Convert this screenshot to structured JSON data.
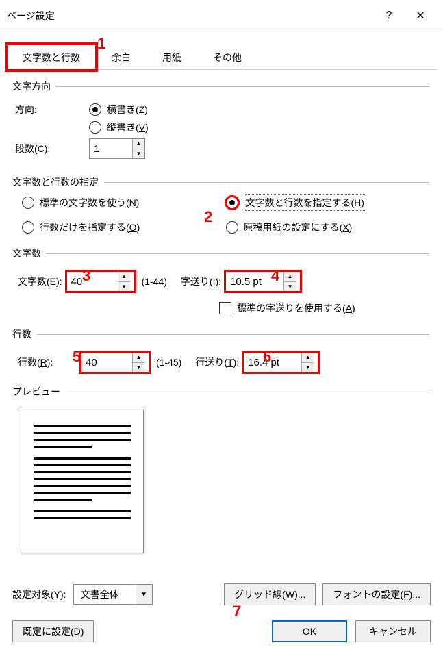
{
  "titlebar": {
    "title": "ページ設定",
    "help_icon": "?",
    "close_icon": "✕"
  },
  "tabs": {
    "t1": "文字数と行数",
    "t2": "余白",
    "t3": "用紙",
    "t4": "その他"
  },
  "direction": {
    "legend": "文字方向",
    "label_direction": "方向:",
    "opt_horizontal": "横書き(Z)",
    "opt_vertical": "縦書き(V)",
    "label_cols": "段数(C):",
    "cols_value": "1"
  },
  "spec": {
    "legend": "文字数と行数の指定",
    "opt_standard": "標準の文字数を使う(N)",
    "opt_specify": "文字数と行数を指定する(H)",
    "opt_linesonly": "行数だけを指定する(O)",
    "opt_manuscript": "原稿用紙の設定にする(X)"
  },
  "chars": {
    "legend": "文字数",
    "label_count": "文字数(E):",
    "count_value": "40",
    "count_range": "(1-44)",
    "label_pitch": "字送り(I):",
    "pitch_value": "10.5 pt",
    "label_default_pitch": "標準の字送りを使用する(A)"
  },
  "lines": {
    "legend": "行数",
    "label_count": "行数(R):",
    "count_value": "40",
    "count_range": "(1-45)",
    "label_pitch": "行送り(T):",
    "pitch_value": "16.4 pt"
  },
  "preview": {
    "legend": "プレビュー"
  },
  "apply": {
    "label": "設定対象(Y):",
    "value": "文書全体",
    "btn_grid": "グリッド線(W)...",
    "btn_font": "フォントの設定(F)..."
  },
  "footer": {
    "default": "既定に設定(D)",
    "ok": "OK",
    "cancel": "キャンセル"
  },
  "callouts": {
    "c1": "1",
    "c2": "2",
    "c3": "3",
    "c4": "4",
    "c5": "5",
    "c6": "6",
    "c7": "7"
  }
}
